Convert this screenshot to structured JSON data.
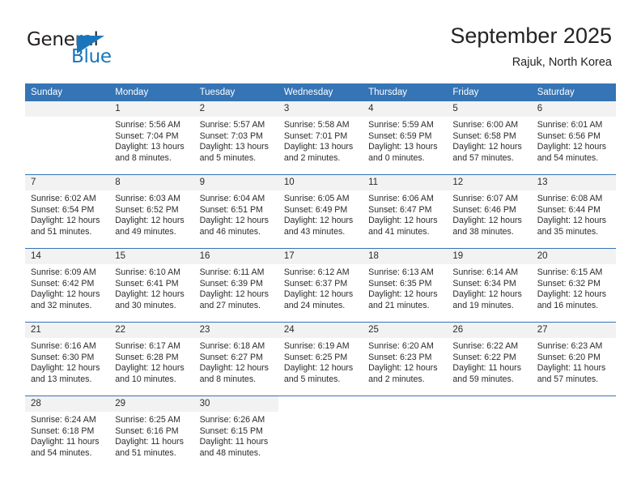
{
  "brand": {
    "name_part1": "General",
    "name_part2": "Blue",
    "logo_icon": "triangle-logo-icon",
    "color_dark": "#231f20",
    "color_blue": "#1b75bb"
  },
  "header": {
    "title": "September 2025",
    "subtitle": "Rajuk, North Korea"
  },
  "theme": {
    "header_blue": "#3574b5",
    "daynum_band": "#f2f2f2",
    "text": "#2b2b2b"
  },
  "weekdays": [
    "Sunday",
    "Monday",
    "Tuesday",
    "Wednesday",
    "Thursday",
    "Friday",
    "Saturday"
  ],
  "weeks": [
    [
      {
        "day": "",
        "sunrise": "",
        "sunset": "",
        "daylight1": "",
        "daylight2": "",
        "empty": true
      },
      {
        "day": "1",
        "sunrise": "Sunrise: 5:56 AM",
        "sunset": "Sunset: 7:04 PM",
        "daylight1": "Daylight: 13 hours",
        "daylight2": "and 8 minutes."
      },
      {
        "day": "2",
        "sunrise": "Sunrise: 5:57 AM",
        "sunset": "Sunset: 7:03 PM",
        "daylight1": "Daylight: 13 hours",
        "daylight2": "and 5 minutes."
      },
      {
        "day": "3",
        "sunrise": "Sunrise: 5:58 AM",
        "sunset": "Sunset: 7:01 PM",
        "daylight1": "Daylight: 13 hours",
        "daylight2": "and 2 minutes."
      },
      {
        "day": "4",
        "sunrise": "Sunrise: 5:59 AM",
        "sunset": "Sunset: 6:59 PM",
        "daylight1": "Daylight: 13 hours",
        "daylight2": "and 0 minutes."
      },
      {
        "day": "5",
        "sunrise": "Sunrise: 6:00 AM",
        "sunset": "Sunset: 6:58 PM",
        "daylight1": "Daylight: 12 hours",
        "daylight2": "and 57 minutes."
      },
      {
        "day": "6",
        "sunrise": "Sunrise: 6:01 AM",
        "sunset": "Sunset: 6:56 PM",
        "daylight1": "Daylight: 12 hours",
        "daylight2": "and 54 minutes."
      }
    ],
    [
      {
        "day": "7",
        "sunrise": "Sunrise: 6:02 AM",
        "sunset": "Sunset: 6:54 PM",
        "daylight1": "Daylight: 12 hours",
        "daylight2": "and 51 minutes."
      },
      {
        "day": "8",
        "sunrise": "Sunrise: 6:03 AM",
        "sunset": "Sunset: 6:52 PM",
        "daylight1": "Daylight: 12 hours",
        "daylight2": "and 49 minutes."
      },
      {
        "day": "9",
        "sunrise": "Sunrise: 6:04 AM",
        "sunset": "Sunset: 6:51 PM",
        "daylight1": "Daylight: 12 hours",
        "daylight2": "and 46 minutes."
      },
      {
        "day": "10",
        "sunrise": "Sunrise: 6:05 AM",
        "sunset": "Sunset: 6:49 PM",
        "daylight1": "Daylight: 12 hours",
        "daylight2": "and 43 minutes."
      },
      {
        "day": "11",
        "sunrise": "Sunrise: 6:06 AM",
        "sunset": "Sunset: 6:47 PM",
        "daylight1": "Daylight: 12 hours",
        "daylight2": "and 41 minutes."
      },
      {
        "day": "12",
        "sunrise": "Sunrise: 6:07 AM",
        "sunset": "Sunset: 6:46 PM",
        "daylight1": "Daylight: 12 hours",
        "daylight2": "and 38 minutes."
      },
      {
        "day": "13",
        "sunrise": "Sunrise: 6:08 AM",
        "sunset": "Sunset: 6:44 PM",
        "daylight1": "Daylight: 12 hours",
        "daylight2": "and 35 minutes."
      }
    ],
    [
      {
        "day": "14",
        "sunrise": "Sunrise: 6:09 AM",
        "sunset": "Sunset: 6:42 PM",
        "daylight1": "Daylight: 12 hours",
        "daylight2": "and 32 minutes."
      },
      {
        "day": "15",
        "sunrise": "Sunrise: 6:10 AM",
        "sunset": "Sunset: 6:41 PM",
        "daylight1": "Daylight: 12 hours",
        "daylight2": "and 30 minutes."
      },
      {
        "day": "16",
        "sunrise": "Sunrise: 6:11 AM",
        "sunset": "Sunset: 6:39 PM",
        "daylight1": "Daylight: 12 hours",
        "daylight2": "and 27 minutes."
      },
      {
        "day": "17",
        "sunrise": "Sunrise: 6:12 AM",
        "sunset": "Sunset: 6:37 PM",
        "daylight1": "Daylight: 12 hours",
        "daylight2": "and 24 minutes."
      },
      {
        "day": "18",
        "sunrise": "Sunrise: 6:13 AM",
        "sunset": "Sunset: 6:35 PM",
        "daylight1": "Daylight: 12 hours",
        "daylight2": "and 21 minutes."
      },
      {
        "day": "19",
        "sunrise": "Sunrise: 6:14 AM",
        "sunset": "Sunset: 6:34 PM",
        "daylight1": "Daylight: 12 hours",
        "daylight2": "and 19 minutes."
      },
      {
        "day": "20",
        "sunrise": "Sunrise: 6:15 AM",
        "sunset": "Sunset: 6:32 PM",
        "daylight1": "Daylight: 12 hours",
        "daylight2": "and 16 minutes."
      }
    ],
    [
      {
        "day": "21",
        "sunrise": "Sunrise: 6:16 AM",
        "sunset": "Sunset: 6:30 PM",
        "daylight1": "Daylight: 12 hours",
        "daylight2": "and 13 minutes."
      },
      {
        "day": "22",
        "sunrise": "Sunrise: 6:17 AM",
        "sunset": "Sunset: 6:28 PM",
        "daylight1": "Daylight: 12 hours",
        "daylight2": "and 10 minutes."
      },
      {
        "day": "23",
        "sunrise": "Sunrise: 6:18 AM",
        "sunset": "Sunset: 6:27 PM",
        "daylight1": "Daylight: 12 hours",
        "daylight2": "and 8 minutes."
      },
      {
        "day": "24",
        "sunrise": "Sunrise: 6:19 AM",
        "sunset": "Sunset: 6:25 PM",
        "daylight1": "Daylight: 12 hours",
        "daylight2": "and 5 minutes."
      },
      {
        "day": "25",
        "sunrise": "Sunrise: 6:20 AM",
        "sunset": "Sunset: 6:23 PM",
        "daylight1": "Daylight: 12 hours",
        "daylight2": "and 2 minutes."
      },
      {
        "day": "26",
        "sunrise": "Sunrise: 6:22 AM",
        "sunset": "Sunset: 6:22 PM",
        "daylight1": "Daylight: 11 hours",
        "daylight2": "and 59 minutes."
      },
      {
        "day": "27",
        "sunrise": "Sunrise: 6:23 AM",
        "sunset": "Sunset: 6:20 PM",
        "daylight1": "Daylight: 11 hours",
        "daylight2": "and 57 minutes."
      }
    ],
    [
      {
        "day": "28",
        "sunrise": "Sunrise: 6:24 AM",
        "sunset": "Sunset: 6:18 PM",
        "daylight1": "Daylight: 11 hours",
        "daylight2": "and 54 minutes."
      },
      {
        "day": "29",
        "sunrise": "Sunrise: 6:25 AM",
        "sunset": "Sunset: 6:16 PM",
        "daylight1": "Daylight: 11 hours",
        "daylight2": "and 51 minutes."
      },
      {
        "day": "30",
        "sunrise": "Sunrise: 6:26 AM",
        "sunset": "Sunset: 6:15 PM",
        "daylight1": "Daylight: 11 hours",
        "daylight2": "and 48 minutes."
      },
      {
        "day": "",
        "sunrise": "",
        "sunset": "",
        "daylight1": "",
        "daylight2": "",
        "blank": true
      },
      {
        "day": "",
        "sunrise": "",
        "sunset": "",
        "daylight1": "",
        "daylight2": "",
        "blank": true
      },
      {
        "day": "",
        "sunrise": "",
        "sunset": "",
        "daylight1": "",
        "daylight2": "",
        "blank": true
      },
      {
        "day": "",
        "sunrise": "",
        "sunset": "",
        "daylight1": "",
        "daylight2": "",
        "blank": true
      }
    ]
  ]
}
